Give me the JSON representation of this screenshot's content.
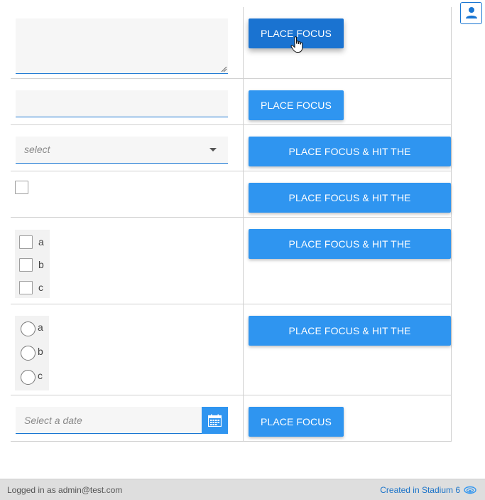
{
  "rows": [
    {
      "control": "textarea",
      "button_label": "PLACE FOCUS"
    },
    {
      "control": "textbox",
      "button_label": "PLACE FOCUS"
    },
    {
      "control": "dropdown",
      "placeholder": "select",
      "button_label": "PLACE FOCUS & HIT THE SPACEBAR"
    },
    {
      "control": "checkbox",
      "button_label": "PLACE FOCUS & HIT THE SPACEBAR"
    },
    {
      "control": "checkbox-list",
      "options": [
        "a",
        "b",
        "c"
      ],
      "button_label": "PLACE FOCUS & HIT THE SPACEBAR"
    },
    {
      "control": "radio-list",
      "options": [
        "a",
        "b",
        "c"
      ],
      "button_label": "PLACE FOCUS & HIT THE SPACEBAR"
    },
    {
      "control": "datepicker",
      "placeholder": "Select a date",
      "button_label": "PLACE FOCUS"
    }
  ],
  "header": {
    "user_icon": "user-icon"
  },
  "footer": {
    "login_text": "Logged in as admin@test.com",
    "created_text": "Created in Stadium 6",
    "logo_icon": "stadium-logo-icon"
  },
  "colors": {
    "button": "#2f95f0",
    "button_hover": "#1a73d1",
    "underline": "#1976d2",
    "link": "#1a73c8"
  }
}
